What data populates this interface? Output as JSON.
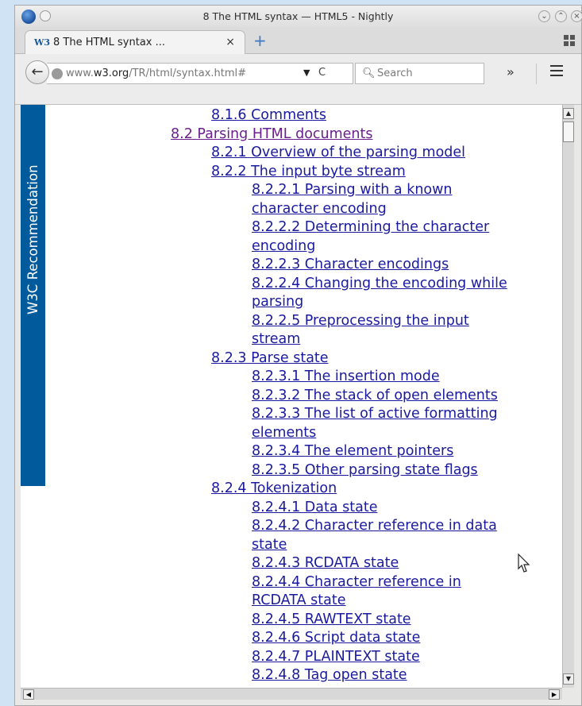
{
  "window": {
    "title": "8 The HTML syntax — HTML5 - Nightly"
  },
  "tab": {
    "favicon_text": "W3",
    "label": "8 The HTML syntax ...",
    "close": "×",
    "new_tab": "+"
  },
  "nav": {
    "back": "←",
    "url_host_prefix": "www.",
    "url_host": "w3.org",
    "url_path": "/TR/html/syntax.html#",
    "url_dropdown": "▼",
    "reload": "C",
    "search_placeholder": "Search",
    "overflow": "»"
  },
  "banner": {
    "text": "W3C Recommendation"
  },
  "toc": [
    {
      "text": "8.1.6 Comments",
      "level": 3
    },
    {
      "text": "8.2 Parsing HTML documents",
      "level": 2,
      "visited": true
    },
    {
      "text": "8.2.1 Overview of the parsing model",
      "level": 3
    },
    {
      "text": "8.2.2 The input byte stream",
      "level": 3
    },
    {
      "text": "8.2.2.1 Parsing with a known",
      "level": 4
    },
    {
      "text": "character encoding",
      "level": 4
    },
    {
      "text": "8.2.2.2 Determining the character",
      "level": 4
    },
    {
      "text": "encoding",
      "level": 4
    },
    {
      "text": "8.2.2.3 Character encodings",
      "level": 4
    },
    {
      "text": "8.2.2.4 Changing the encoding while",
      "level": 4
    },
    {
      "text": "parsing",
      "level": 4
    },
    {
      "text": "8.2.2.5 Preprocessing the input",
      "level": 4
    },
    {
      "text": "stream",
      "level": 4
    },
    {
      "text": "8.2.3 Parse state",
      "level": 3
    },
    {
      "text": "8.2.3.1 The insertion mode",
      "level": 4
    },
    {
      "text": "8.2.3.2 The stack of open elements",
      "level": 4
    },
    {
      "text": "8.2.3.3 The list of active formatting",
      "level": 4
    },
    {
      "text": "elements",
      "level": 4
    },
    {
      "text": "8.2.3.4 The element pointers",
      "level": 4
    },
    {
      "text": "8.2.3.5 Other parsing state flags",
      "level": 4
    },
    {
      "text": "8.2.4 Tokenization",
      "level": 3
    },
    {
      "text": "8.2.4.1 Data state",
      "level": 4
    },
    {
      "text": "8.2.4.2 Character reference in data",
      "level": 4
    },
    {
      "text": "state",
      "level": 4
    },
    {
      "text": "8.2.4.3 RCDATA state",
      "level": 4
    },
    {
      "text": "8.2.4.4 Character reference in",
      "level": 4
    },
    {
      "text": "RCDATA state",
      "level": 4
    },
    {
      "text": "8.2.4.5 RAWTEXT state",
      "level": 4
    },
    {
      "text": "8.2.4.6 Script data state",
      "level": 4
    },
    {
      "text": "8.2.4.7 PLAINTEXT state",
      "level": 4
    },
    {
      "text": "8.2.4.8 Tag open state",
      "level": 4
    }
  ],
  "colors": {
    "link": "#1a1a9e",
    "visited_link": "#6a1f8f",
    "w3c_banner": "#005a9c"
  }
}
